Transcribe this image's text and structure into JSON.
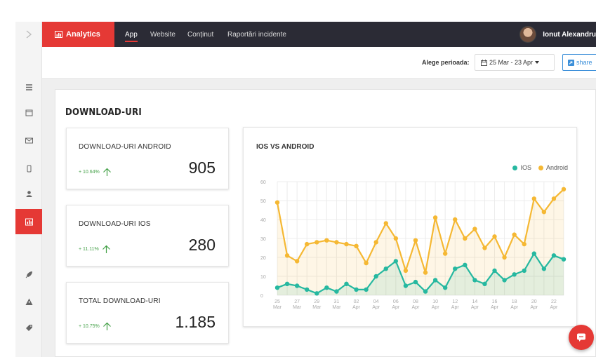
{
  "topbar": {
    "brand_label": "Analytics",
    "nav": [
      {
        "label": "App",
        "active": true
      },
      {
        "label": "Website",
        "active": false
      },
      {
        "label": "Conținut",
        "active": false
      },
      {
        "label": "Raportări incidente",
        "active": false
      }
    ],
    "user_name": "Ionut Alexandru"
  },
  "subbar": {
    "period_label": "Alege perioada:",
    "period_value": "25 Mar - 23 Apr",
    "share_label": "share"
  },
  "sidebar": {
    "items": [
      {
        "icon": "list-icon",
        "active": false
      },
      {
        "icon": "calendar-icon",
        "active": false
      },
      {
        "icon": "envelope-icon",
        "active": false
      },
      {
        "icon": "mobile-icon",
        "active": false
      },
      {
        "icon": "user-icon",
        "active": false
      },
      {
        "icon": "chart-icon",
        "active": true
      },
      {
        "icon": "rocket-icon",
        "active": false
      },
      {
        "icon": "warning-icon",
        "active": false
      },
      {
        "icon": "tag-icon",
        "active": false
      }
    ]
  },
  "section_title": "DOWNLOAD-URI",
  "cards": [
    {
      "title": "DOWNLOAD-URI ANDROID",
      "pct": "+ 10.64%",
      "value": "905"
    },
    {
      "title": "DOWNLOAD-URI IOS",
      "pct": "+ 11.11%",
      "value": "280"
    },
    {
      "title": "TOTAL DOWNLOAD-URI",
      "pct": "+ 10.75%",
      "value": "1.185"
    }
  ],
  "colors": {
    "accent": "#e53935",
    "topbar": "#2b2b35",
    "ios": "#26b8a0",
    "android": "#f5b833",
    "positive": "#43a047"
  },
  "chart_data": {
    "type": "line",
    "title": "IOS VS ANDROID",
    "ylim": [
      0,
      60
    ],
    "yticks": [
      0,
      10,
      20,
      30,
      40,
      50,
      60
    ],
    "x": [
      "25 Mar",
      "26 Mar",
      "27 Mar",
      "28 Mar",
      "29 Mar",
      "30 Mar",
      "31 Mar",
      "01 Apr",
      "02 Apr",
      "03 Apr",
      "04 Apr",
      "05 Apr",
      "06 Apr",
      "07 Apr",
      "08 Apr",
      "09 Apr",
      "10 Apr",
      "11 Apr",
      "12 Apr",
      "13 Apr",
      "14 Apr",
      "15 Apr",
      "16 Apr",
      "17 Apr",
      "18 Apr",
      "19 Apr",
      "20 Apr",
      "21 Apr",
      "22 Apr",
      "23 Apr"
    ],
    "xtick_labels": [
      [
        "25",
        "Mar"
      ],
      [
        "27",
        "Mar"
      ],
      [
        "29",
        "Mar"
      ],
      [
        "31",
        "Mar"
      ],
      [
        "02",
        "Apr"
      ],
      [
        "04",
        "Apr"
      ],
      [
        "06",
        "Apr"
      ],
      [
        "08",
        "Apr"
      ],
      [
        "10",
        "Apr"
      ],
      [
        "12",
        "Apr"
      ],
      [
        "14",
        "Apr"
      ],
      [
        "16",
        "Apr"
      ],
      [
        "18",
        "Apr"
      ],
      [
        "20",
        "Apr"
      ],
      [
        "22",
        "Apr"
      ]
    ],
    "legend_position": "top-right",
    "series": [
      {
        "name": "IOS",
        "color": "#26b8a0",
        "values": [
          4,
          6,
          5,
          3,
          1,
          4,
          2,
          6,
          3,
          3,
          10,
          14,
          18,
          5,
          7,
          2,
          8,
          4,
          14,
          16,
          8,
          6,
          13,
          8,
          11,
          13,
          22,
          14,
          21,
          19
        ]
      },
      {
        "name": "Android",
        "color": "#f5b833",
        "values": [
          49,
          21,
          18,
          27,
          28,
          29,
          28,
          27,
          26,
          17,
          28,
          38,
          30,
          13,
          29,
          12,
          41,
          22,
          40,
          30,
          35,
          25,
          31,
          20,
          32,
          27,
          51,
          44,
          51,
          56
        ]
      }
    ]
  }
}
